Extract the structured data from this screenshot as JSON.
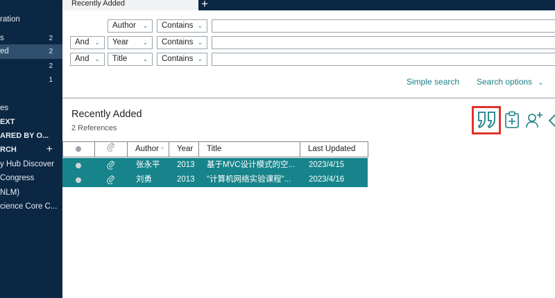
{
  "sidebar": {
    "items": [
      {
        "label": "ration",
        "count": ""
      },
      {
        "label": "s",
        "count": "2"
      },
      {
        "label": "ed",
        "count": "2"
      },
      {
        "label": "",
        "count": "2"
      },
      {
        "label": "",
        "count": "1"
      },
      {
        "label": "es",
        "count": ""
      },
      {
        "label": "EXT",
        "count": ""
      },
      {
        "label": "ARED BY O...",
        "count": ""
      },
      {
        "label": "RCH",
        "count": ""
      },
      {
        "label": "y Hub Discover",
        "count": ""
      },
      {
        "label": " Congress",
        "count": ""
      },
      {
        "label": "NLM)",
        "count": ""
      },
      {
        "label": "cience Core C...",
        "count": ""
      }
    ],
    "add_symbol": "+"
  },
  "tabs": {
    "active_label": "Recently Added",
    "add_symbol": "+"
  },
  "search": {
    "rows": [
      {
        "connector": "",
        "field": "Author",
        "operator": "Contains",
        "value": ""
      },
      {
        "connector": "And",
        "field": "Year",
        "operator": "Contains",
        "value": ""
      },
      {
        "connector": "And",
        "field": "Title",
        "operator": "Contains",
        "value": ""
      }
    ],
    "chevron": "⌄",
    "simple_search": "Simple search",
    "search_options": "Search options"
  },
  "collection": {
    "title": "Recently Added",
    "subtitle": "2 References"
  },
  "table": {
    "columns": [
      "Author",
      "Year",
      "Title",
      "Last Updated"
    ],
    "sort_indicator": "^",
    "rows": [
      {
        "author": "张永平",
        "year": "2013",
        "title": "基于MVC设计模式的空...",
        "updated": "2023/4/15"
      },
      {
        "author": "刘勇",
        "year": "2013",
        "title": "\"计算机网络实验课程\"...",
        "updated": "2023/4/16"
      }
    ]
  },
  "colors": {
    "sidebar_bg": "#0b2743",
    "accent": "#1a7f86",
    "row_selected": "#16848a",
    "highlight_box": "#e0342c"
  }
}
